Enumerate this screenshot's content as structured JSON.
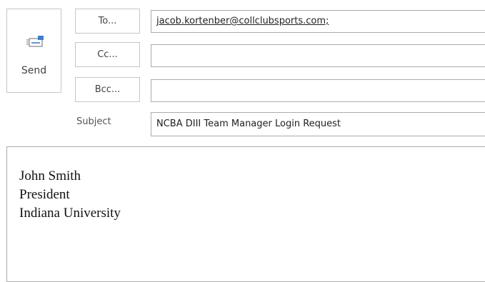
{
  "send": {
    "label": "Send",
    "icon": "send-icon"
  },
  "address_buttons": {
    "to": "To...",
    "cc": "Cc...",
    "bcc": "Bcc..."
  },
  "fields": {
    "to_value": "jacob.kortenber@collclubsports.com;",
    "cc_value": "",
    "bcc_value": "",
    "subject_label": "Subject",
    "subject_value": "NCBA DIII Team Manager Login Request"
  },
  "body": {
    "lines": [
      "John Smith",
      "President",
      "Indiana University"
    ]
  }
}
